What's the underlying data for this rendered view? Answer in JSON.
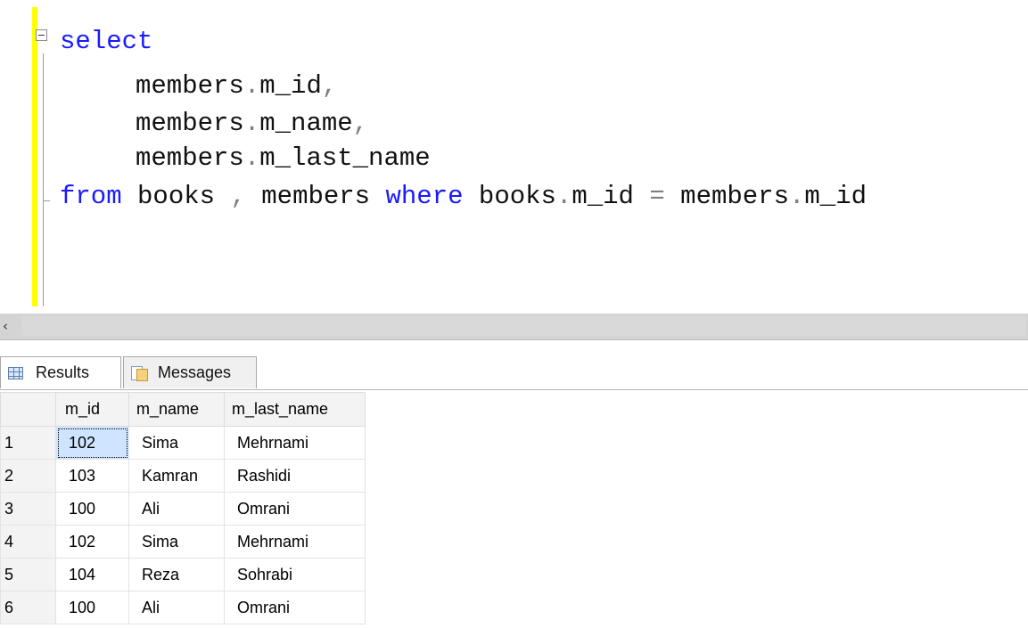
{
  "editor": {
    "lines": [
      {
        "parts": [
          {
            "t": "select",
            "c": "kw"
          }
        ]
      },
      {
        "parts": [
          {
            "t": "members",
            "c": ""
          },
          {
            "t": ".",
            "c": "op"
          },
          {
            "t": "m_id",
            "c": ""
          },
          {
            "t": ",",
            "c": "op"
          }
        ]
      },
      {
        "parts": [
          {
            "t": "members",
            "c": ""
          },
          {
            "t": ".",
            "c": "op"
          },
          {
            "t": "m_name",
            "c": ""
          },
          {
            "t": ",",
            "c": "op"
          }
        ]
      },
      {
        "parts": [
          {
            "t": "members",
            "c": ""
          },
          {
            "t": ".",
            "c": "op"
          },
          {
            "t": "m_last_name",
            "c": ""
          }
        ]
      },
      {
        "parts": [
          {
            "t": "from",
            "c": "kw"
          },
          {
            "t": " books ",
            "c": ""
          },
          {
            "t": ",",
            "c": "op"
          },
          {
            "t": " members ",
            "c": ""
          },
          {
            "t": "where",
            "c": "kw"
          },
          {
            "t": " books",
            "c": ""
          },
          {
            "t": ".",
            "c": "op"
          },
          {
            "t": "m_id ",
            "c": ""
          },
          {
            "t": "=",
            "c": "op"
          },
          {
            "t": " members",
            "c": ""
          },
          {
            "t": ".",
            "c": "op"
          },
          {
            "t": "m_id",
            "c": ""
          }
        ]
      }
    ]
  },
  "scrollbar": {
    "left_arrow_glyph": "‹"
  },
  "results": {
    "tabs": [
      {
        "label": "Results",
        "icon": "grid-icon"
      },
      {
        "label": "Messages",
        "icon": "messages-icon"
      }
    ],
    "columns": [
      "m_id",
      "m_name",
      "m_last_name"
    ],
    "rows": [
      {
        "num": "1",
        "cells": [
          "102",
          "Sima",
          "Mehrnami"
        ]
      },
      {
        "num": "2",
        "cells": [
          "103",
          "Kamran",
          "Rashidi"
        ]
      },
      {
        "num": "3",
        "cells": [
          "100",
          "Ali",
          "Omrani"
        ]
      },
      {
        "num": "4",
        "cells": [
          "102",
          "Sima",
          "Mehrnami"
        ]
      },
      {
        "num": "5",
        "cells": [
          "104",
          "Reza",
          "Sohrabi"
        ]
      },
      {
        "num": "6",
        "cells": [
          "100",
          "Ali",
          "Omrani"
        ]
      }
    ],
    "selected_cell": {
      "row": 0,
      "col": 0
    }
  }
}
